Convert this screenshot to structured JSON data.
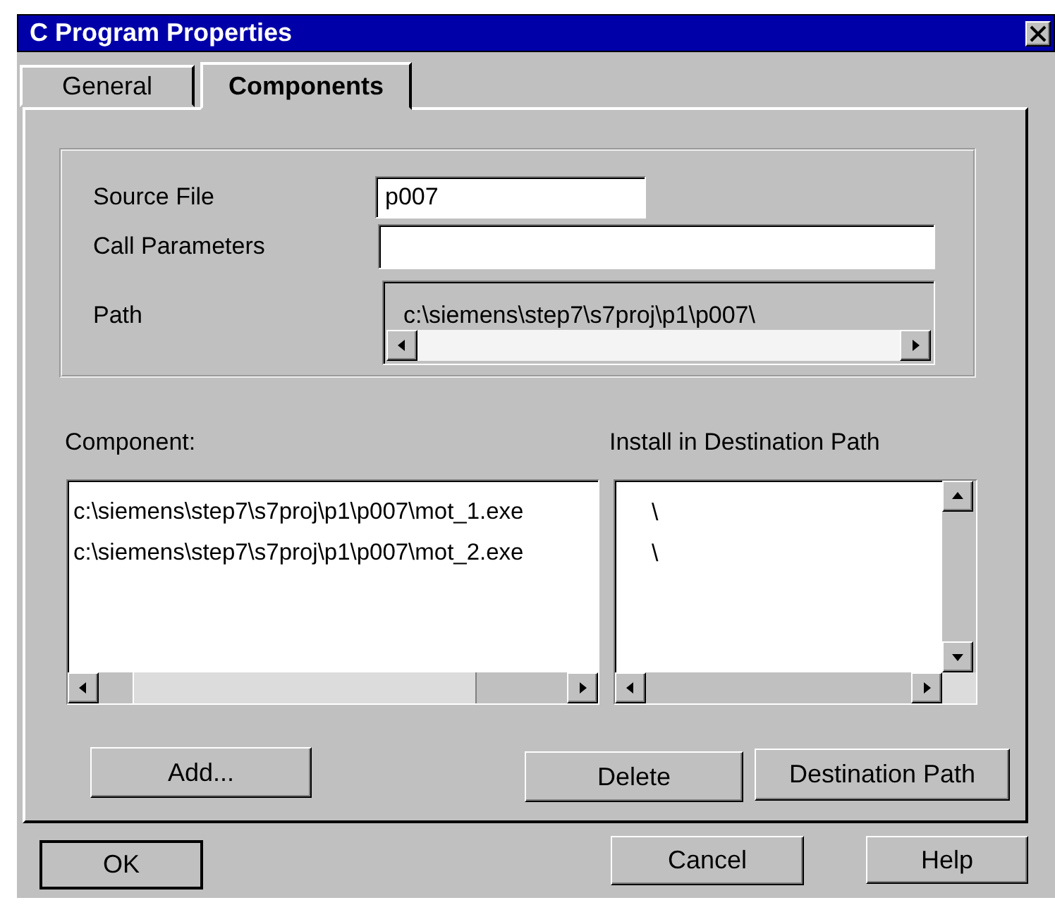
{
  "window": {
    "title": "C Program Properties"
  },
  "tabs": [
    {
      "label": "General",
      "selected": false
    },
    {
      "label": "Components",
      "selected": true
    }
  ],
  "fields": [
    {
      "label": "Source File",
      "value": "p007"
    },
    {
      "label": "Call Parameters"
    }
  ],
  "path": {
    "label": "Path",
    "value": "c:\\siemens\\step7\\s7proj\\p1\\p007\\"
  },
  "components": {
    "columns": [
      "Component:",
      "Install in Destination Path"
    ],
    "rows": [
      {
        "component": "c:\\siemens\\step7\\s7proj\\p1\\p007\\mot_1.exe",
        "destination": "\\"
      },
      {
        "component": "c:\\siemens\\step7\\s7proj\\p1\\p007\\mot_2.exe",
        "destination": "\\"
      }
    ]
  },
  "panel_buttons": [
    {
      "label": "Add...",
      "default": false
    },
    {
      "label": "Delete",
      "default": false
    },
    {
      "label": "Destination Path",
      "default": false
    }
  ],
  "buttons": [
    {
      "label": "OK",
      "default": true
    },
    {
      "label": "Cancel",
      "default": false
    },
    {
      "label": "Help",
      "default": false
    }
  ]
}
